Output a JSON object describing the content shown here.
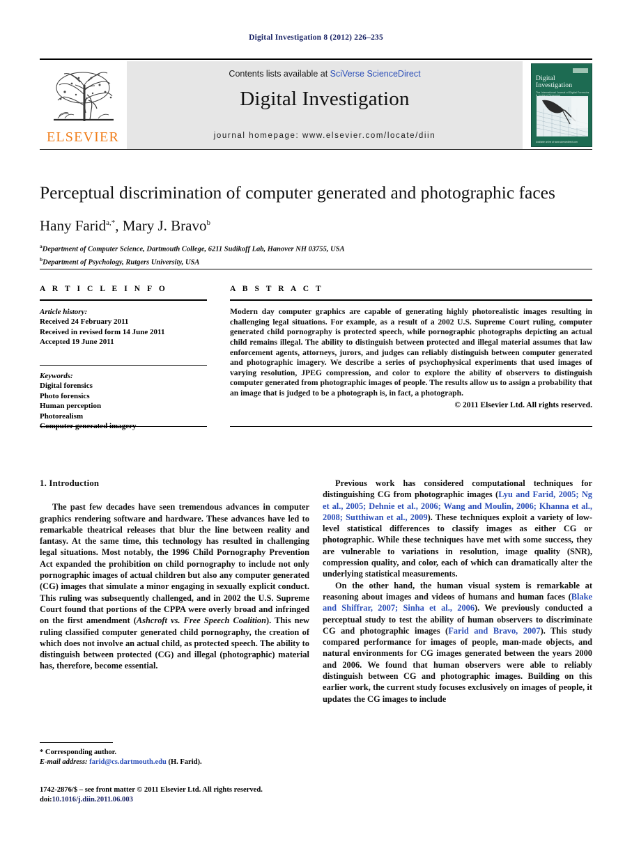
{
  "running_head": "Digital Investigation 8 (2012) 226–235",
  "masthead": {
    "publisher_logo_text": "ELSEVIER",
    "contents_prefix": "Contents lists available at",
    "contents_link": "SciVerse ScienceDirect",
    "journal_name": "Digital Investigation",
    "homepage": "journal homepage: www.elsevier.com/locate/diin",
    "cover": {
      "title_line1": "Digital",
      "title_line2": "Investigation",
      "subtitle": "The International Journal of Digital Forensics & Incident Response",
      "footer": "Available online at www.sciencedirect.com"
    }
  },
  "article": {
    "title": "Perceptual discrimination of computer generated and photographic faces",
    "authors": "Hany Farid",
    "author_marks_a": "a,*",
    "authors_second": ", Mary J. Bravo",
    "author_marks_b": "b",
    "affiliation_a_mark": "a",
    "affiliation_a": "Department of Computer Science, Dartmouth College, 6211 Sudikoff Lab, Hanover NH 03755, USA",
    "affiliation_b_mark": "b",
    "affiliation_b": "Department of Psychology, Rutgers University, USA"
  },
  "info": {
    "heading": "A R T I C L E  I N F O",
    "history_label": "Article history:",
    "history": [
      "Received 24 February 2011",
      "Received in revised form 14 June 2011",
      "Accepted 19 June 2011"
    ],
    "keywords_label": "Keywords:",
    "keywords": [
      "Digital forensics",
      "Photo forensics",
      "Human perception",
      "Photorealism",
      "Computer generated imagery"
    ]
  },
  "abstract": {
    "heading": "A B S T R A C T",
    "text": "Modern day computer graphics are capable of generating highly photorealistic images resulting in challenging legal situations. For example, as a result of a 2002 U.S. Supreme Court ruling, computer generated child pornography is protected speech, while pornographic photographs depicting an actual child remains illegal. The ability to distinguish between protected and illegal material assumes that law enforcement agents, attorneys, jurors, and judges can reliably distinguish between computer generated and photographic imagery. We describe a series of psychophysical experiments that used images of varying resolution, JPEG compression, and color to explore the ability of observers to distinguish computer generated from photographic images of people. The results allow us to assign a probability that an image that is judged to be a photograph is, in fact, a photograph.",
    "copyright": "© 2011 Elsevier Ltd. All rights reserved."
  },
  "body": {
    "section_heading": "1. Introduction",
    "left_p1": "The past few decades have seen tremendous advances in computer graphics rendering software and hardware. These advances have led to remarkable theatrical releases that blur the line between reality and fantasy. At the same time, this technology has resulted in challenging legal situations. Most notably, the 1996 Child Pornography Prevention Act expanded the prohibition on child pornography to include not only pornographic images of actual children but also any computer generated (CG) images that simulate a minor engaging in sexually explicit conduct. This ruling was subsequently challenged, and in 2002 the U.S. Supreme Court found that portions of the CPPA were overly broad and infringed on the first amendment (",
    "left_p1_case1": "Ashcroft vs. Free Speech Coalition",
    "left_p1_tail": "). This new ruling classified computer generated child pornography, the creation of which does not involve an actual child, as protected speech. The ability to distinguish between protected (CG) and illegal (photographic) material has, therefore, become essential.",
    "right_p1_a": "Previous work has considered computational techniques for distinguishing CG from photographic images (",
    "right_p1_refs": "Lyu and Farid, 2005; Ng et al., 2005; Dehnie et al., 2006; Wang and Moulin, 2006; Khanna et al., 2008; Sutthiwan et al., 2009",
    "right_p1_b": "). These techniques exploit a variety of low-level statistical differences to classify images as either CG or photographic. While these techniques have met with some success, they are vulnerable to variations in resolution, image quality (SNR), compression quality, and color, each of which can dramatically alter the underlying statistical measurements.",
    "right_p2_a": "On the other hand, the human visual system is remarkable at reasoning about images and videos of humans and human faces (",
    "right_p2_refs1": "Blake and Shiffrar, 2007; Sinha et al., 2006",
    "right_p2_b": "). We previously conducted a perceptual study to test the ability of human observers to discriminate CG and photographic images (",
    "right_p2_refs2": "Farid and Bravo, 2007",
    "right_p2_c": "). This study compared performance for images of people, man-made objects, and natural environments for CG images generated between the years 2000 and 2006. We found that human observers were able to reliably distinguish between CG and photographic images. Building on this earlier work, the current study focuses exclusively on images of people, it updates the CG images to include"
  },
  "footnotes": {
    "corresponding": "* Corresponding author.",
    "email_label": "E-mail address:",
    "email": "farid@cs.dartmouth.edu",
    "email_suffix": "(H. Farid).",
    "imprint": "1742-2876/$ – see front matter © 2011 Elsevier Ltd. All rights reserved.",
    "doi_label": "doi:",
    "doi": "10.1016/j.diin.2011.06.003"
  }
}
